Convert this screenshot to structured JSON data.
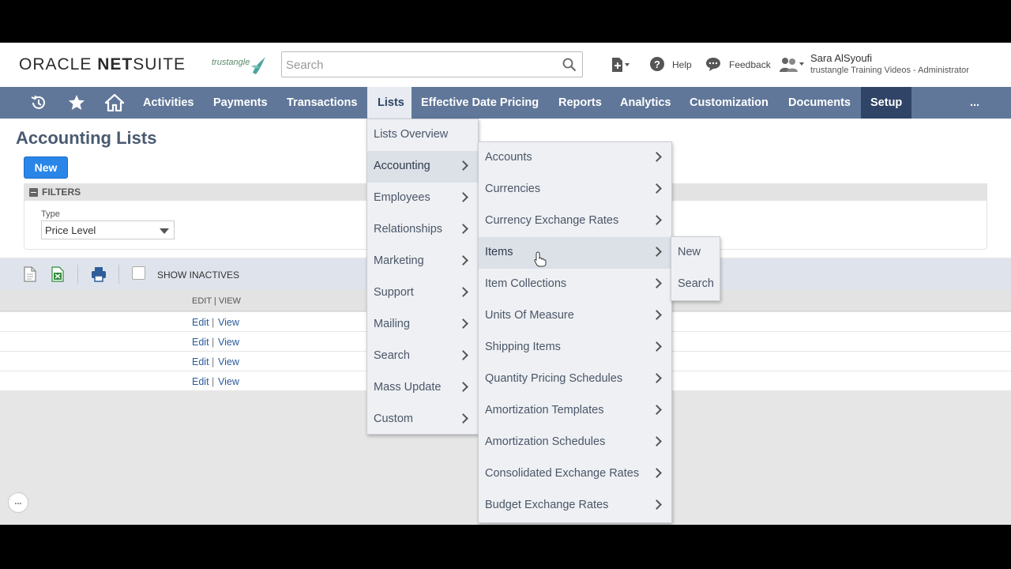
{
  "header": {
    "logo_part1": "ORACLE",
    "logo_part2": " NET",
    "logo_part3": "SUITE",
    "brand_name": "trustangle",
    "search_placeholder": "Search",
    "help_label": "Help",
    "feedback_label": "Feedback",
    "user_name": "Sara AlSyoufi",
    "user_role": "trustangle Training Videos - Administrator"
  },
  "nav": {
    "items": [
      "Activities",
      "Payments",
      "Transactions",
      "Lists",
      "Effective Date Pricing",
      "Reports",
      "Analytics",
      "Customization",
      "Documents",
      "Setup"
    ],
    "more": "...",
    "active": "Lists"
  },
  "page": {
    "title": "Accounting Lists",
    "new_button": "New",
    "filters_label": "FILTERS",
    "type_label": "Type",
    "type_value": "Price Level",
    "show_inactives": "SHOW INACTIVES",
    "column_header": "EDIT | VIEW",
    "rows": [
      {
        "edit": "Edit",
        "sep": "|",
        "view": "View"
      },
      {
        "edit": "Edit",
        "sep": "|",
        "view": "View"
      },
      {
        "edit": "Edit",
        "sep": "|",
        "view": "View"
      },
      {
        "edit": "Edit",
        "sep": "|",
        "view": "View"
      }
    ],
    "chat_button": "..."
  },
  "menus": {
    "lists": [
      "Lists Overview",
      "Accounting",
      "Employees",
      "Relationships",
      "Marketing",
      "Support",
      "Mailing",
      "Search",
      "Mass Update",
      "Custom"
    ],
    "accounting": [
      "Accounts",
      "Currencies",
      "Currency Exchange Rates",
      "Items",
      "Item Collections",
      "Units Of Measure",
      "Shipping Items",
      "Quantity Pricing Schedules",
      "Amortization Templates",
      "Amortization Schedules",
      "Consolidated Exchange Rates",
      "Budget Exchange Rates"
    ],
    "items": [
      "New",
      "Search"
    ]
  },
  "colors": {
    "nav_bg": "#607799",
    "setup_bg": "#2f4466",
    "new_button": "#2a85e8",
    "toolbar_bg": "#dfe4ec"
  }
}
